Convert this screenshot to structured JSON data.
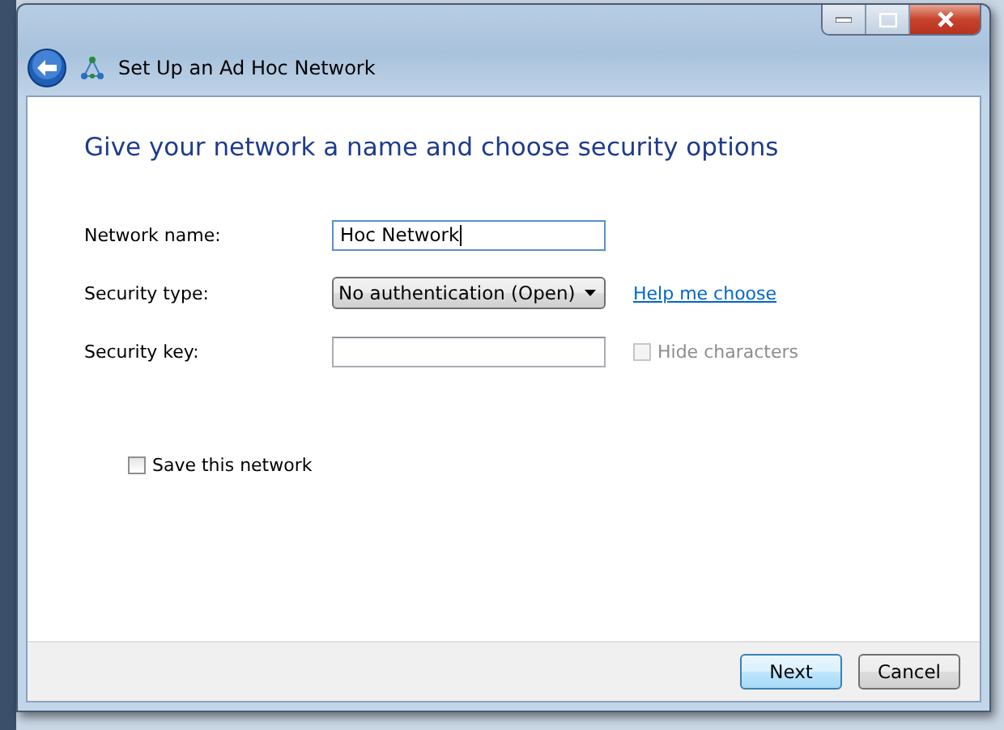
{
  "window": {
    "title": "Set Up an Ad Hoc Network"
  },
  "heading": "Give your network a name and choose security options",
  "fields": [
    {
      "kind": "text",
      "label": "Network name:",
      "value": "Hoc Network",
      "focused": true
    },
    {
      "kind": "dropdown",
      "label": "Security type:",
      "value": "No authentication (Open)",
      "link": "Help me choose"
    },
    {
      "kind": "text",
      "label": "Security key:",
      "focused": false,
      "option": {
        "label": "Hide characters",
        "checked": false,
        "disabled": true
      }
    }
  ],
  "save_network": {
    "label": "Save this network",
    "checked": false
  },
  "buttons": [
    {
      "label": "Next",
      "default": true
    },
    {
      "label": "Cancel",
      "default": false
    }
  ]
}
